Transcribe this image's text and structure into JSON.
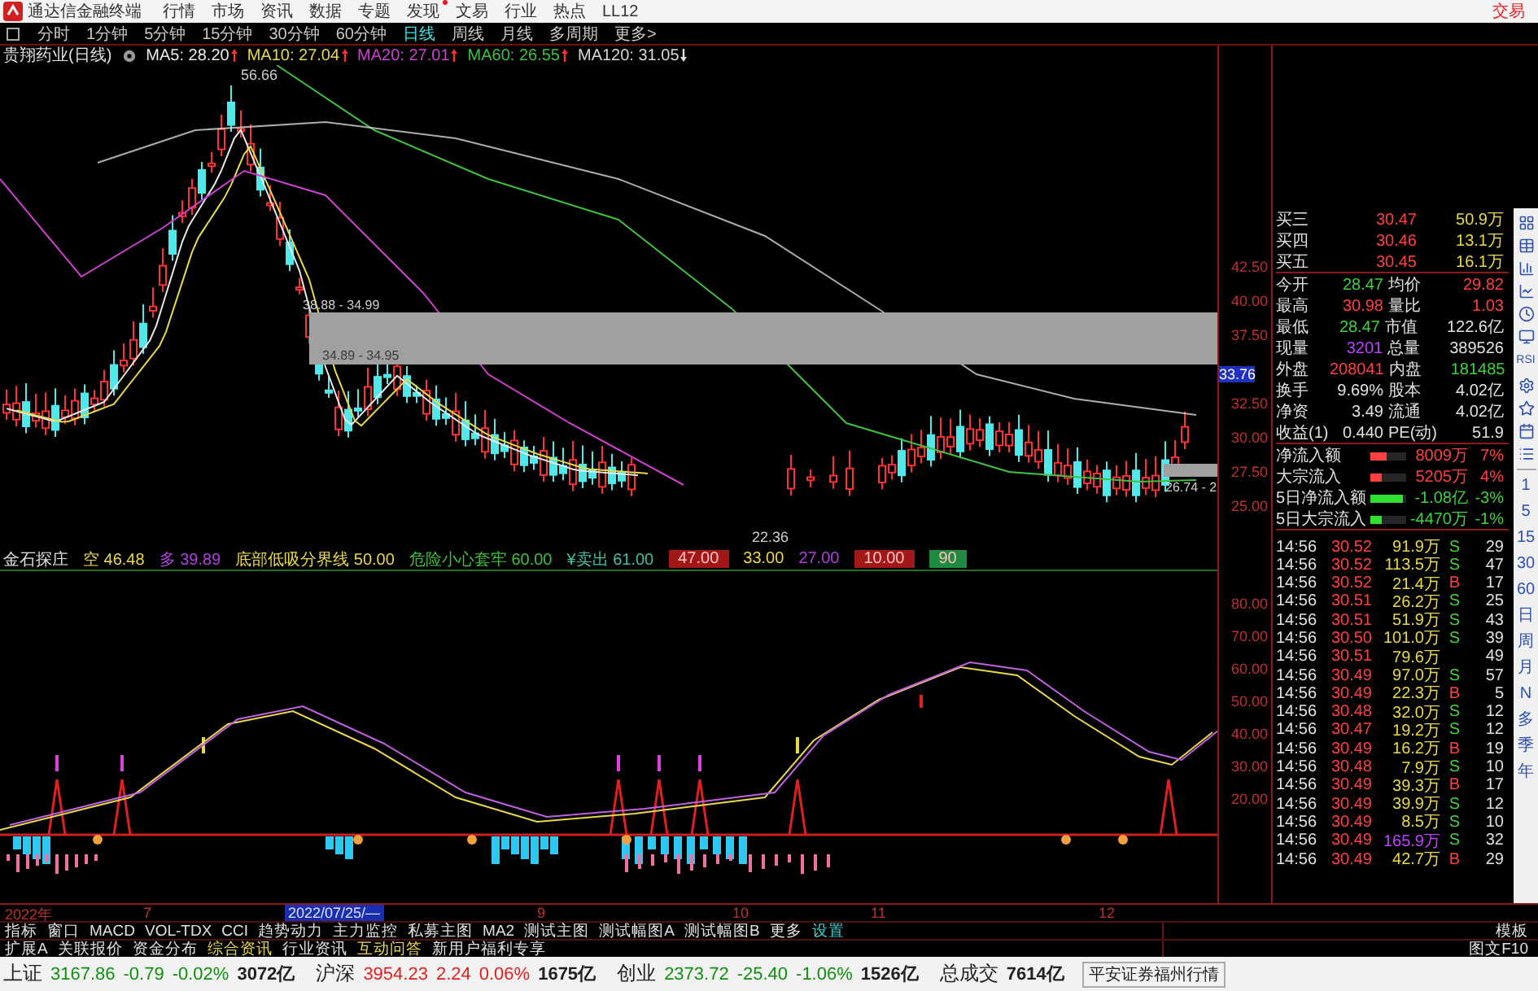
{
  "menu_bar": {
    "app_title": "通达信金融终端",
    "items": [
      {
        "label": "行情",
        "dot": false
      },
      {
        "label": "市场",
        "dot": false
      },
      {
        "label": "资讯",
        "dot": false
      },
      {
        "label": "数据",
        "dot": false
      },
      {
        "label": "专题",
        "dot": false
      },
      {
        "label": "发现",
        "dot": true
      },
      {
        "label": "文易",
        "dot": false
      },
      {
        "label": "行业",
        "dot": false
      },
      {
        "label": "热点",
        "dot": false
      },
      {
        "label": "LL12",
        "dot": false
      }
    ],
    "trade_button": "交易"
  },
  "period_bar": {
    "items": [
      {
        "label": "分时",
        "selected": false
      },
      {
        "label": "1分钟",
        "selected": false
      },
      {
        "label": "5分钟",
        "selected": false
      },
      {
        "label": "15分钟",
        "selected": false
      },
      {
        "label": "30分钟",
        "selected": false
      },
      {
        "label": "60分钟",
        "selected": false
      },
      {
        "label": "日线",
        "selected": true
      },
      {
        "label": "周线",
        "selected": false
      },
      {
        "label": "月线",
        "selected": false
      },
      {
        "label": "多周期",
        "selected": false
      },
      {
        "label": "更多>",
        "selected": false
      }
    ]
  },
  "price_chart": {
    "title": "贵翔药业(日线)",
    "moving_averages": [
      {
        "label": "MA5: 28.20",
        "color": "#e8e8e8",
        "rising": true
      },
      {
        "label": "MA10: 27.04",
        "color": "#e8d84a",
        "rising": true
      },
      {
        "label": "MA20: 27.01",
        "color": "#d040d0",
        "rising": true
      },
      {
        "label": "MA60: 26.55",
        "color": "#40c040",
        "rising": true
      },
      {
        "label": "MA120: 31.05",
        "color": "#d8d8d8",
        "rising": false
      }
    ],
    "high_label": "56.66",
    "low_label": "22.36",
    "band_upper_label": "38.88 - 34.99",
    "band_lower_label": "34.89 - 34.95",
    "right_range_label": "26.74 - 2",
    "axis_ticks": [
      "42.50",
      "40.00",
      "37.50",
      "32.50",
      "30.00",
      "27.50",
      "25.00"
    ],
    "price_tag": "33.76"
  },
  "indicator_bar": {
    "name": "金石探庄",
    "items": [
      {
        "label": "空",
        "value": "46.48",
        "color": "#e8d84a",
        "kind": "text"
      },
      {
        "label": "多",
        "value": "39.89",
        "color": "#b040e0",
        "kind": "text"
      },
      {
        "label": "底部低吸分界线",
        "value": "50.00",
        "color": "#e8d84a",
        "kind": "text"
      },
      {
        "label": "危险小心套牢",
        "value": "60.00",
        "color": "#40c040",
        "kind": "text"
      },
      {
        "label": "¥卖出",
        "value": "61.00",
        "color": "#40c0a0",
        "kind": "text"
      },
      {
        "value": "47.00",
        "color": "#a01818",
        "kind": "badge"
      },
      {
        "value": "33.00",
        "color": "#e8d84a",
        "kind": "text"
      },
      {
        "value": "27.00",
        "color": "#b040e0",
        "kind": "text"
      },
      {
        "value": "10.00",
        "color": "#a01818",
        "kind": "badge"
      },
      {
        "value": "90",
        "color": "#208a40",
        "kind": "badge"
      }
    ]
  },
  "oscillator_chart": {
    "axis_ticks": [
      "80.00",
      "70.00",
      "60.00",
      "50.00",
      "40.00",
      "30.00",
      "20.00"
    ]
  },
  "date_axis": {
    "labels": [
      "2022年",
      "7",
      "9",
      "10",
      "11",
      "12"
    ],
    "cursor_date": "2022/07/25/—"
  },
  "quote_panel": {
    "order_book": [
      {
        "label": "买三",
        "price": "30.47",
        "volume": "50.9万"
      },
      {
        "label": "买四",
        "price": "30.46",
        "volume": "13.1万"
      },
      {
        "label": "买五",
        "price": "30.45",
        "volume": "16.1万"
      }
    ],
    "stats": [
      {
        "cells": [
          {
            "label": "今开",
            "value": "28.47",
            "color": "#40d040"
          },
          {
            "label": "均价",
            "value": "29.82",
            "color": "#ff4040"
          }
        ]
      },
      {
        "cells": [
          {
            "label": "最高",
            "value": "30.98",
            "color": "#ff4040"
          },
          {
            "label": "量比",
            "value": "1.03",
            "color": "#ff4040"
          }
        ]
      },
      {
        "cells": [
          {
            "label": "最低",
            "value": "28.47",
            "color": "#40d040"
          },
          {
            "label": "市值",
            "value": "122.6亿",
            "color": "#e0e0e0"
          }
        ]
      },
      {
        "cells": [
          {
            "label": "现量",
            "value": "3201",
            "color": "#c040ff"
          },
          {
            "label": "总量",
            "value": "389526",
            "color": "#e0e0e0"
          }
        ]
      },
      {
        "cells": [
          {
            "label": "外盘",
            "value": "208041",
            "color": "#ff4040"
          },
          {
            "label": "内盘",
            "value": "181485",
            "color": "#40d040"
          }
        ]
      },
      {
        "cells": [
          {
            "label": "换手",
            "value": "9.69%",
            "color": "#e0e0e0"
          },
          {
            "label": "股本",
            "value": "4.02亿",
            "color": "#e0e0e0"
          }
        ]
      },
      {
        "cells": [
          {
            "label": "净资",
            "value": "3.49",
            "color": "#e0e0e0"
          },
          {
            "label": "流通",
            "value": "4.02亿",
            "color": "#e0e0e0"
          }
        ]
      },
      {
        "cells": [
          {
            "label": "收益(1)",
            "value": "0.440",
            "color": "#e0e0e0"
          },
          {
            "label": "PE(动)",
            "value": "51.9",
            "color": "#e0e0e0"
          }
        ]
      }
    ],
    "flows": [
      {
        "label": "净流入额",
        "kind": "inflow",
        "level": 0.45,
        "value": "8009万",
        "pct": "7%"
      },
      {
        "label": "大宗流入",
        "kind": "inflow",
        "level": 0.3,
        "value": "5205万",
        "pct": "4%"
      },
      {
        "label": "5日净流入额",
        "kind": "outflow",
        "level": 0.9,
        "value": "-1.08亿",
        "pct": "-3%"
      },
      {
        "label": "5日大宗流入",
        "kind": "outflow",
        "level": 0.3,
        "value": "-4470万",
        "pct": "-1%"
      }
    ],
    "trades": [
      {
        "time": "14:56",
        "price": "30.52",
        "volume": "91.9万",
        "side": "S",
        "kind": "sell",
        "count": "29",
        "large": false
      },
      {
        "time": "14:56",
        "price": "30.52",
        "volume": "113.5万",
        "side": "S",
        "kind": "sell",
        "count": "47",
        "large": false
      },
      {
        "time": "14:56",
        "price": "30.52",
        "volume": "21.4万",
        "side": "B",
        "kind": "buy",
        "count": "17",
        "large": false
      },
      {
        "time": "14:56",
        "price": "30.51",
        "volume": "26.2万",
        "side": "S",
        "kind": "sell",
        "count": "25",
        "large": false
      },
      {
        "time": "14:56",
        "price": "30.51",
        "volume": "51.9万",
        "side": "S",
        "kind": "sell",
        "count": "43",
        "large": false
      },
      {
        "time": "14:56",
        "price": "30.50",
        "volume": "101.0万",
        "side": "S",
        "kind": "sell",
        "count": "39",
        "large": false
      },
      {
        "time": "14:56",
        "price": "30.51",
        "volume": "79.6万",
        "kind": "none",
        "count": "49",
        "large": false
      },
      {
        "time": "14:56",
        "price": "30.49",
        "volume": "97.0万",
        "side": "S",
        "kind": "sell",
        "count": "57",
        "large": false
      },
      {
        "time": "14:56",
        "price": "30.49",
        "volume": "22.3万",
        "side": "B",
        "kind": "buy",
        "count": "5",
        "large": false
      },
      {
        "time": "14:56",
        "price": "30.48",
        "volume": "32.0万",
        "side": "S",
        "kind": "sell",
        "count": "12",
        "large": false
      },
      {
        "time": "14:56",
        "price": "30.47",
        "volume": "19.2万",
        "side": "S",
        "kind": "sell",
        "count": "12",
        "large": false
      },
      {
        "time": "14:56",
        "price": "30.49",
        "volume": "16.2万",
        "side": "B",
        "kind": "buy",
        "count": "19",
        "large": false
      },
      {
        "time": "14:56",
        "price": "30.48",
        "volume": "7.9万",
        "side": "S",
        "kind": "sell",
        "count": "10",
        "large": false
      },
      {
        "time": "14:56",
        "price": "30.49",
        "volume": "39.3万",
        "side": "B",
        "kind": "buy",
        "count": "17",
        "large": false
      },
      {
        "time": "14:56",
        "price": "30.49",
        "volume": "39.9万",
        "side": "S",
        "kind": "sell",
        "count": "12",
        "large": false
      },
      {
        "time": "14:56",
        "price": "30.49",
        "volume": "8.5万",
        "side": "S",
        "kind": "sell",
        "count": "10",
        "large": false
      },
      {
        "time": "14:56",
        "price": "30.49",
        "volume": "165.9万",
        "side": "S",
        "kind": "sell",
        "count": "32",
        "large": true
      },
      {
        "time": "14:56",
        "price": "30.49",
        "volume": "42.7万",
        "side": "B",
        "kind": "buy",
        "count": "29",
        "large": false
      }
    ]
  },
  "side_toolbar": {
    "label": "RSI",
    "periods": [
      "1",
      "5",
      "15",
      "30",
      "60",
      "日",
      "周",
      "月",
      "N",
      "多",
      "季",
      "年"
    ]
  },
  "bottom_tabs": {
    "rows": [
      {
        "items": [
          {
            "label": "指标",
            "color": "#e0e0e0"
          },
          {
            "label": "窗口",
            "color": "#e0e0e0"
          },
          {
            "label": "MACD",
            "color": "#e0e0e0"
          },
          {
            "label": "VOL-TDX",
            "color": "#e0e0e0"
          },
          {
            "label": "CCI",
            "color": "#e0e0e0"
          },
          {
            "label": "趋势动力",
            "color": "#e0e0e0"
          },
          {
            "label": "主力监控",
            "color": "#e0e0e0"
          },
          {
            "label": "私募主图",
            "color": "#e0e0e0"
          },
          {
            "label": "MA2",
            "color": "#e0e0e0"
          },
          {
            "label": "测试主图",
            "color": "#e0e0e0"
          },
          {
            "label": "测试幅图A",
            "color": "#e0e0e0"
          },
          {
            "label": "测试幅图B",
            "color": "#e0e0e0"
          },
          {
            "label": "更多",
            "color": "#e0e0e0"
          },
          {
            "label": "设置",
            "color": "#40d0d0"
          }
        ],
        "right": "模板"
      },
      {
        "items": [
          {
            "label": "扩展A",
            "color": "#e0e0e0"
          },
          {
            "label": "关联报价",
            "color": "#e0e0e0"
          },
          {
            "label": "资金分布",
            "color": "#e0e0e0"
          },
          {
            "label": "综合资讯",
            "color": "#e8d84a"
          },
          {
            "label": "行业资讯",
            "color": "#e0e0e0"
          },
          {
            "label": "互动问答",
            "color": "#e8d84a"
          },
          {
            "label": "新用户福利专享",
            "color": "#e0e0e0"
          }
        ],
        "right": "图文F10"
      }
    ]
  },
  "status_bar": {
    "indices": [
      {
        "name": "上证",
        "value": "3167.86",
        "change": "-0.79",
        "pct": "-0.02%",
        "amount": "3072亿",
        "rising": false
      },
      {
        "name": "沪深",
        "value": "3954.23",
        "change": "2.24",
        "pct": "0.06%",
        "amount": "1675亿",
        "rising": true
      },
      {
        "name": "创业",
        "value": "2373.72",
        "change": "-25.40",
        "pct": "-1.06%",
        "amount": "1526亿",
        "rising": false
      }
    ],
    "total_label": "总成交",
    "total_value": "7614亿",
    "broker": "平安证券福州行情"
  }
}
